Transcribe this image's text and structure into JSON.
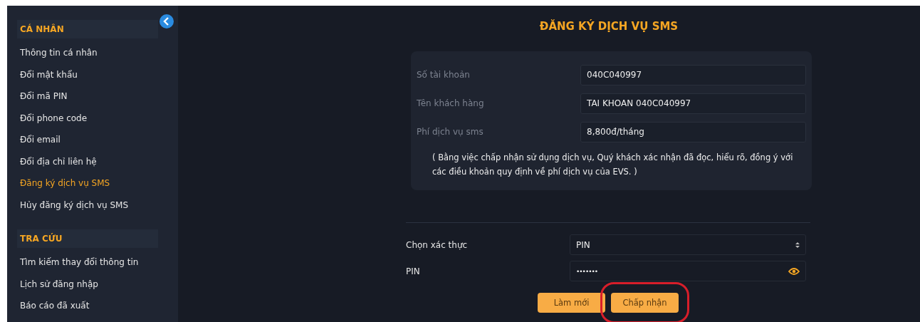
{
  "sidebar": {
    "sections": [
      {
        "title": "CÁ NHÂN",
        "items": [
          {
            "label": "Thông tin cá nhân",
            "selected": false
          },
          {
            "label": "Đổi mật khẩu",
            "selected": false
          },
          {
            "label": "Đổi mã PIN",
            "selected": false
          },
          {
            "label": "Đổi phone code",
            "selected": false
          },
          {
            "label": "Đổi email",
            "selected": false
          },
          {
            "label": "Đổi địa chỉ liên hệ",
            "selected": false
          },
          {
            "label": "Đăng ký dịch vụ SMS",
            "selected": true
          },
          {
            "label": "Hủy đăng ký dịch vụ SMS",
            "selected": false
          }
        ]
      },
      {
        "title": "TRA CỨU",
        "items": [
          {
            "label": "Tìm kiếm thay đổi thông tin",
            "selected": false
          },
          {
            "label": "Lịch sử đăng nhập",
            "selected": false
          },
          {
            "label": "Báo cáo đã xuất",
            "selected": false
          }
        ]
      }
    ]
  },
  "title": "ĐĂNG KÝ DỊCH VỤ SMS",
  "info_fields": [
    {
      "label": "Số tài khoản",
      "value": "040C040997"
    },
    {
      "label": "Tên khách hàng",
      "value": "TAI KHOAN 040C040997"
    },
    {
      "label": "Phí dịch vụ sms",
      "value": "8,800đ/tháng"
    }
  ],
  "note": "( Bằng việc chấp nhận sử dụng dịch vụ, Quý khách xác nhận đã đọc, hiểu rõ, đồng ý với các điều khoản quy định về phí dịch vụ của EVS. )",
  "auth_fields": [
    {
      "label": "Chọn xác thực",
      "kind": "select",
      "value": "PIN"
    },
    {
      "label": "PIN",
      "kind": "password",
      "value": "•••••••"
    }
  ],
  "buttons": [
    {
      "label": "Làm mới",
      "highlighted": false
    },
    {
      "label": "Chấp nhận",
      "highlighted": true
    }
  ]
}
